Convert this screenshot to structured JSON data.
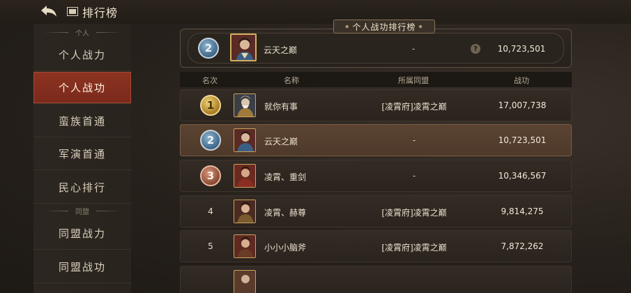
{
  "header": {
    "title": "排行榜",
    "back_icon": "back-arrow-icon",
    "title_icon": "scroll-icon"
  },
  "sidebar": {
    "section_personal": "个人",
    "section_alliance": "同盟",
    "items": [
      {
        "label": "个人战力",
        "active": false
      },
      {
        "label": "个人战功",
        "active": true
      },
      {
        "label": "蛮族首通",
        "active": false
      },
      {
        "label": "军演首通",
        "active": false
      },
      {
        "label": "民心排行",
        "active": false
      },
      {
        "label": "同盟战力",
        "active": false
      },
      {
        "label": "同盟战功",
        "active": false
      }
    ]
  },
  "board_title": "个人战功排行榜",
  "my_entry": {
    "rank": "2",
    "name": "云天之巅",
    "alliance": "-",
    "help": "?",
    "merit": "10,723,501"
  },
  "table": {
    "headers": [
      "名次",
      "名称",
      "所属同盟",
      "战功"
    ],
    "rows": [
      {
        "rank": "1",
        "medal": "gold",
        "name": "就你有事",
        "alliance": "[凌霄府]凌霄之巅",
        "merit": "17,007,738"
      },
      {
        "rank": "2",
        "medal": "silver",
        "name": "云天之巅",
        "alliance": "-",
        "merit": "10,723,501",
        "highlight": true
      },
      {
        "rank": "3",
        "medal": "bronze",
        "name": "凌霄、重剑",
        "alliance": "-",
        "merit": "10,346,567"
      },
      {
        "rank": "4",
        "medal": "",
        "name": "凌霄、赫尊",
        "alliance": "[凌霄府]凌霄之巅",
        "merit": "9,814,275"
      },
      {
        "rank": "5",
        "medal": "",
        "name": "小小小脑斧",
        "alliance": "[凌霄府]凌霄之巅",
        "merit": "7,872,262"
      }
    ]
  },
  "colors": {
    "active_tab": "#8d3322",
    "highlight_row": "#5b4331",
    "gold": "#e0b54a",
    "silver": "#5f88a8",
    "bronze": "#b06a50"
  }
}
